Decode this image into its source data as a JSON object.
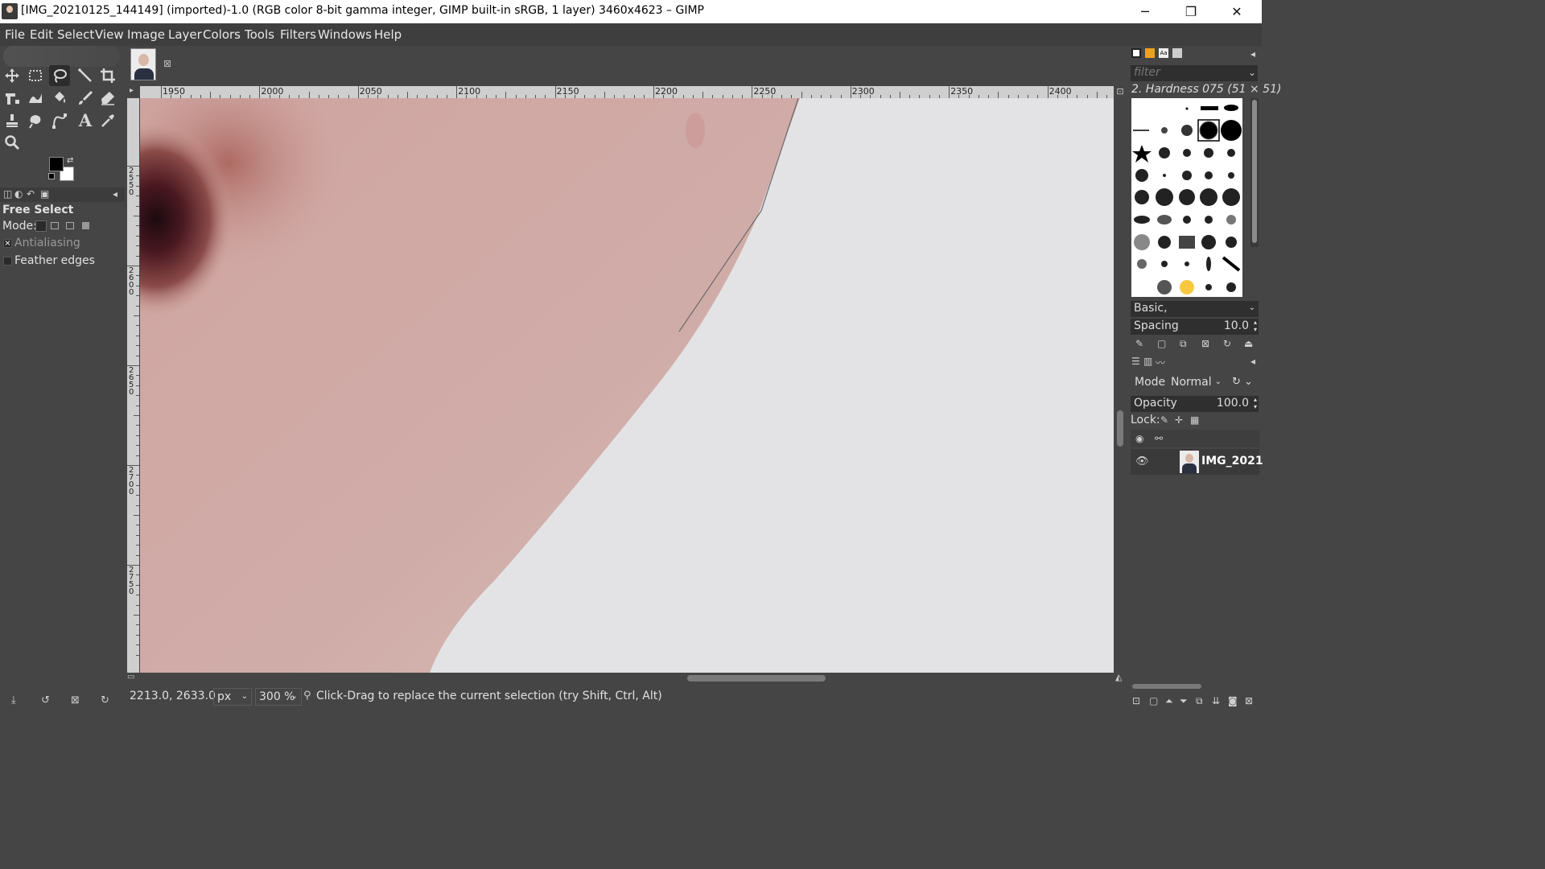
{
  "window": {
    "title": "[IMG_20210125_144149] (imported)-1.0 (RGB color 8-bit gamma integer, GIMP built-in sRGB, 1 layer) 3460x4623 – GIMP",
    "minimize": "─",
    "maximize": "❐",
    "close": "✕"
  },
  "menu": [
    "File",
    "Edit",
    "Select",
    "View",
    "Image",
    "Layer",
    "Colors",
    "Tools",
    "Filters",
    "Windows",
    "Help"
  ],
  "tool_options": {
    "title": "Free Select",
    "mode_label": "Mode:",
    "antialiasing": {
      "label": "Antialiasing",
      "checked": true
    },
    "feather": {
      "label": "Feather edges",
      "checked": false
    }
  },
  "image_tab": {
    "close": "⊠"
  },
  "rulers": {
    "h_labels": [
      "1950",
      "2000",
      "2050",
      "2100",
      "2150",
      "2200",
      "2250",
      "2300",
      "2350",
      "2400"
    ],
    "v_labels": [
      "2550",
      "2600",
      "2650",
      "2700",
      "2750"
    ]
  },
  "status": {
    "coords": "2213.0, 2633.0",
    "unit": "px",
    "zoom": "300 %",
    "message": "Click-Drag to replace the current selection (try Shift, Ctrl, Alt)"
  },
  "brushes": {
    "filter_placeholder": "filter",
    "selected": "2. Hardness 075 (51 × 51)",
    "preset": "Basic,",
    "spacing_label": "Spacing",
    "spacing_value": "10.0"
  },
  "layers": {
    "mode_label": "Mode",
    "mode_value": "Normal",
    "opacity_label": "Opacity",
    "opacity_value": "100.0",
    "lock_label": "Lock:",
    "layer_name": "IMG_2021"
  },
  "colors": {
    "foreground": "#000000",
    "background": "#ffffff",
    "skin": "#d4aca6",
    "backdrop": "#e4e4e6"
  }
}
